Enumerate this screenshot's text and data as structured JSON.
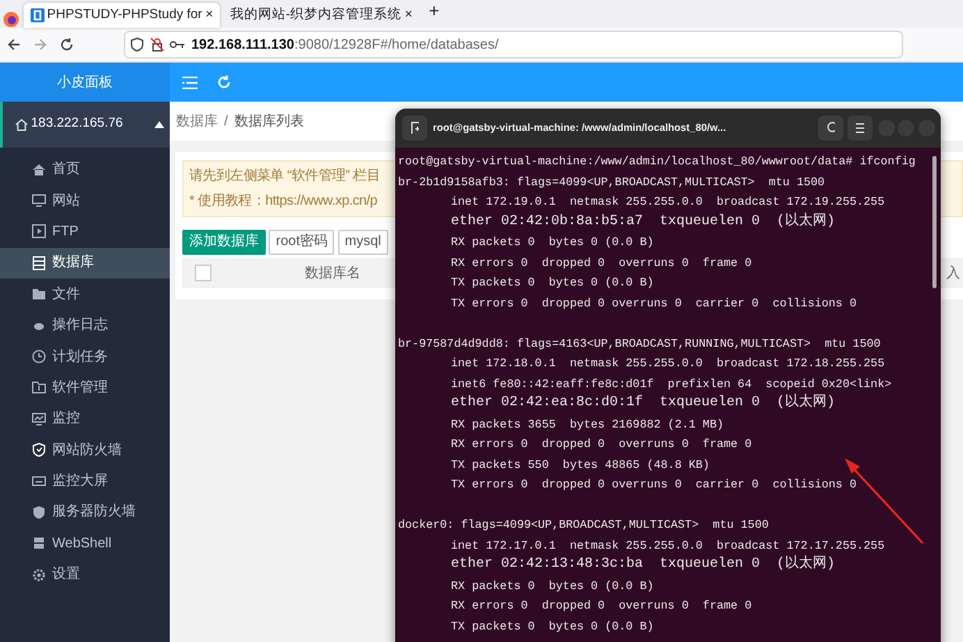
{
  "browser": {
    "tabs": [
      {
        "title": "PHPSTUDY-PHPStudy for",
        "close": "×",
        "selected": true
      },
      {
        "title": "我的网站-织梦内容管理系统",
        "close": "×",
        "selected": false
      }
    ],
    "new_tab": "+",
    "url": "**192.168.111.130**:9080/12928F#/home/databases/"
  },
  "sidebar": {
    "title": "小皮面板",
    "server": "183.222.165.76",
    "expanded": true,
    "items": [
      {
        "label": "首页",
        "selected": false
      },
      {
        "label": "网站",
        "selected": false
      },
      {
        "label": "FTP",
        "selected": false
      },
      {
        "label": "数据库",
        "selected": true
      },
      {
        "label": "文件",
        "selected": false
      },
      {
        "label": "操作日志",
        "selected": false
      },
      {
        "label": "计划任务",
        "selected": false
      },
      {
        "label": "软件管理",
        "selected": false
      },
      {
        "label": "监控",
        "selected": false
      },
      {
        "label": "网站防火墙",
        "selected": false
      },
      {
        "label": "监控大屏",
        "selected": false
      },
      {
        "label": "服务器防火墙",
        "selected": false
      },
      {
        "label": "WebShell",
        "selected": false
      },
      {
        "label": "设置",
        "selected": false
      }
    ]
  },
  "breadcrumb": {
    "items": [
      "数据库",
      "数据库列表"
    ],
    "separator": "/"
  },
  "notice": [
    "请先到左侧菜单 “软件管理” 栏目",
    "* 使用教程：https://www.xp.cn/p"
  ],
  "buttons": [
    {
      "label": "添加数据库",
      "kind": "primary"
    },
    {
      "label": "root密码",
      "kind": "outline"
    },
    {
      "label": "mysql",
      "kind": "outline"
    }
  ],
  "table": {
    "select_all": {
      "checked": false
    },
    "columns": [
      "数据库名",
      "入"
    ]
  },
  "terminal": {
    "title": "root@gatsby-virtual-machine: /www/admin/localhost_80/w...",
    "lines": [
      {
        "kind": "prompt",
        "text": "root@gatsby-virtual-machine:/www/admin/localhost_80/wwwroot/data# ifconfig"
      },
      {
        "kind": "header",
        "text": "br-2b1d9158afb3: flags=4099<UP,BROADCAST,MULTICAST>  mtu 1500"
      },
      {
        "kind": "detail",
        "text": "inet 172.19.0.1  netmask 255.255.0.0  broadcast 172.19.255.255"
      },
      {
        "kind": "detail",
        "text": "ether 02:42:0b:8a:b5:a7  txqueuelen 0  (以太网)"
      },
      {
        "kind": "detail",
        "text": "RX packets 0  bytes 0 (0.0 B)"
      },
      {
        "kind": "detail",
        "text": "RX errors 0  dropped 0  overruns 0  frame 0"
      },
      {
        "kind": "detail",
        "text": "TX packets 0  bytes 0 (0.0 B)"
      },
      {
        "kind": "detail",
        "text": "TX errors 0  dropped 0 overruns 0  carrier 0  collisions 0"
      },
      {
        "kind": "blank"
      },
      {
        "kind": "header",
        "text": "br-97587d4d9dd8: flags=4163<UP,BROADCAST,RUNNING,MULTICAST>  mtu 1500"
      },
      {
        "kind": "detail",
        "text": "inet 172.18.0.1  netmask 255.255.0.0  broadcast 172.18.255.255"
      },
      {
        "kind": "detail",
        "text": "inet6 fe80::42:eaff:fe8c:d01f  prefixlen 64  scopeid 0x20<link>"
      },
      {
        "kind": "detail",
        "text": "ether 02:42:ea:8c:d0:1f  txqueuelen 0  (以太网)"
      },
      {
        "kind": "detail",
        "text": "RX packets 3655  bytes 2169882 (2.1 MB)"
      },
      {
        "kind": "detail",
        "text": "RX errors 0  dropped 0  overruns 0  frame 0"
      },
      {
        "kind": "detail",
        "text": "TX packets 550  bytes 48865 (48.8 KB)"
      },
      {
        "kind": "detail",
        "text": "TX errors 0  dropped 0 overruns 0  carrier 0  collisions 0"
      },
      {
        "kind": "blank"
      },
      {
        "kind": "header",
        "text": "docker0: flags=4099<UP,BROADCAST,MULTICAST>  mtu 1500"
      },
      {
        "kind": "detail",
        "text": "inet 172.17.0.1  netmask 255.255.0.0  broadcast 172.17.255.255"
      },
      {
        "kind": "detail",
        "text": "ether 02:42:13:48:3c:ba  txqueuelen 0  (以太网)"
      },
      {
        "kind": "detail",
        "text": "RX packets 0  bytes 0 (0.0 B)"
      },
      {
        "kind": "detail",
        "text": "RX errors 0  dropped 0  overruns 0  frame 0"
      },
      {
        "kind": "detail",
        "text": "TX packets 0  bytes 0 (0.0 B)"
      }
    ]
  }
}
